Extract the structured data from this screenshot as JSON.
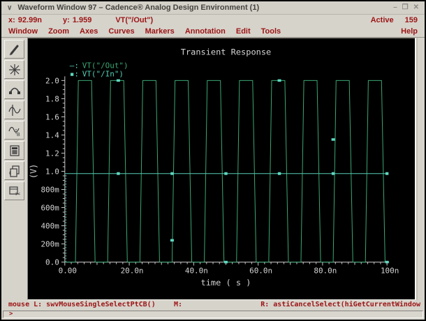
{
  "window": {
    "title": "Waveform Window 97 – Cadence® Analog Design Environment (1)",
    "controls": {
      "minimize": "–",
      "maximize": "❐",
      "close": "✕"
    },
    "chevron": "∨"
  },
  "coord_bar": {
    "x_label": "x:",
    "x_value": "92.99n",
    "y_label": "y:",
    "y_value": "1.959",
    "trace_expr": "VT(\"/Out\")",
    "active_label": "Active",
    "active_value": "159"
  },
  "menu": {
    "items": [
      {
        "label": "Window"
      },
      {
        "label": "Zoom"
      },
      {
        "label": "Axes"
      },
      {
        "label": "Curves"
      },
      {
        "label": "Markers"
      },
      {
        "label": "Annotation"
      },
      {
        "label": "Edit"
      },
      {
        "label": "Tools"
      }
    ],
    "help_label": "Help"
  },
  "toolbar": {
    "icons": [
      "stylus-icon",
      "zoom-star-icon",
      "arc-tool-icon",
      "probe-wave-icon",
      "wave-b-icon",
      "calculator-icon",
      "copy-window-icon",
      "cut-window-icon"
    ]
  },
  "status_bar": {
    "mouse_left": "mouse L: swvMouseSingleSelectPtCB()",
    "mouse_middle": "M:",
    "mouse_right": "R: astiCancelSelect(hiGetCurrentWindow",
    "prompt": ">"
  },
  "colors": {
    "maroon_text": "#9c1414",
    "chrome_gray": "#d6d3cb"
  },
  "chart_data": {
    "type": "line",
    "title": "Transient Response",
    "xlabel": "time ( s )",
    "ylabel": "(V)",
    "xlim": [
      0,
      100
    ],
    "ylim": [
      0,
      2.0
    ],
    "x_unit": "ns",
    "grid": false,
    "bg": "#000000",
    "axis_color": "#c9c9c9",
    "text_color": "#d4d4d4",
    "marker_color": "#5fd8c0",
    "x_ticks": [
      {
        "v": 0,
        "label": "0.00"
      },
      {
        "v": 20,
        "label": "20.0n"
      },
      {
        "v": 40,
        "label": "40.0n"
      },
      {
        "v": 60,
        "label": "60.0n"
      },
      {
        "v": 80,
        "label": "80.0n"
      },
      {
        "v": 100,
        "label": "100n"
      }
    ],
    "y_ticks": [
      {
        "v": 0.0,
        "label": "0.0"
      },
      {
        "v": 0.2,
        "label": "200m"
      },
      {
        "v": 0.4,
        "label": "400m"
      },
      {
        "v": 0.6,
        "label": "600m"
      },
      {
        "v": 0.8,
        "label": "800m"
      },
      {
        "v": 1.0,
        "label": "1.0"
      },
      {
        "v": 1.2,
        "label": "1.2"
      },
      {
        "v": 1.4,
        "label": "1.4"
      },
      {
        "v": 1.6,
        "label": "1.6"
      },
      {
        "v": 1.8,
        "label": "1.8"
      },
      {
        "v": 2.0,
        "label": "2.0"
      }
    ],
    "x_minor_step": 2,
    "x_medium_step": 10,
    "y_minor_divisions": 4,
    "legend_position": "top-left",
    "series": [
      {
        "name": "VT(\"/Out\")",
        "legend_glyph": "–:",
        "color": "#3aa873",
        "shape": "square_wave",
        "low": 0.0,
        "high": 2.0,
        "period": 10,
        "rise_start": 3.3,
        "rise_time": 0.9,
        "high_end": 8.3,
        "fall_time": 1.1,
        "cycles": 10,
        "t_start": 0,
        "t_end": 100
      },
      {
        "name": "VT(\"/In\")",
        "legend_glyph": "▪:",
        "color": "#54cdb4",
        "shape": "constant",
        "value": 0.975,
        "initial_value": 0.0,
        "initial_step_style": "dashed",
        "t_start": 0,
        "t_end": 100,
        "marker_times": [
          16.6,
          33.3,
          50,
          66.6,
          83.3,
          100
        ]
      }
    ],
    "point_markers": [
      {
        "t": 16.6,
        "v": 2.0
      },
      {
        "t": 33.3,
        "v": 0.24
      },
      {
        "t": 50,
        "v": 0.0
      },
      {
        "t": 66.6,
        "v": 2.0
      },
      {
        "t": 83.3,
        "v": 1.35
      },
      {
        "t": 100,
        "v": 0.0
      }
    ]
  }
}
